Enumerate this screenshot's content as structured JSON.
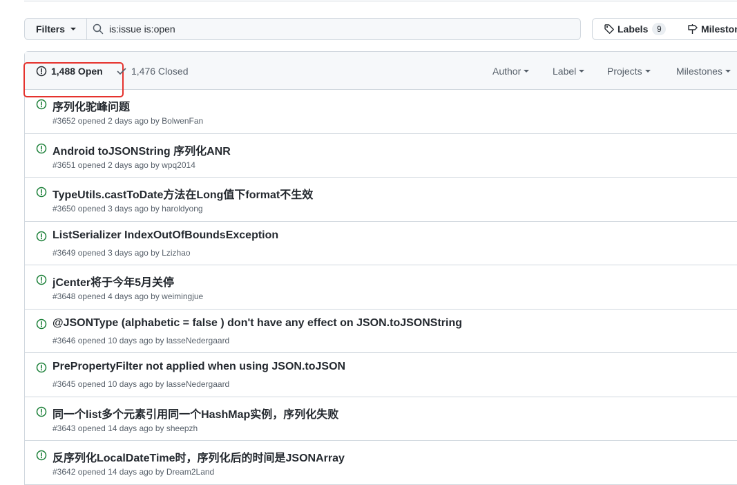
{
  "toolbar": {
    "filters_label": "Filters",
    "search_value": "is:issue is:open",
    "labels_label": "Labels",
    "labels_count": "9",
    "milestones_label": "Milestones"
  },
  "header": {
    "open_label": "1,488 Open",
    "closed_label": "1,476 Closed",
    "menus": [
      "Author",
      "Label",
      "Projects",
      "Milestones"
    ]
  },
  "colors": {
    "open_green": "#1a7f37",
    "highlight_red": "#e5322d"
  },
  "issues": [
    {
      "title": "序列化驼峰问题",
      "number": "#3652",
      "opened": "opened 2 days ago by",
      "author": "BolwenFan"
    },
    {
      "title": "Android toJSONString 序列化ANR",
      "number": "#3651",
      "opened": "opened 2 days ago by",
      "author": "wpq2014"
    },
    {
      "title": "TypeUtils.castToDate方法在Long值下format不生效",
      "number": "#3650",
      "opened": "opened 3 days ago by",
      "author": "haroldyong"
    },
    {
      "title": "ListSerializer IndexOutOfBoundsException",
      "number": "#3649",
      "opened": "opened 3 days ago by",
      "author": "Lzizhao"
    },
    {
      "title": "jCenter将于今年5月关停",
      "number": "#3648",
      "opened": "opened 4 days ago by",
      "author": "weimingjue"
    },
    {
      "title": "@JSONType (alphabetic = false ) don't have any effect on JSON.toJSONString",
      "number": "#3646",
      "opened": "opened 10 days ago by",
      "author": "lasseNedergaard"
    },
    {
      "title": "PrePropertyFilter not applied when using JSON.toJSON",
      "number": "#3645",
      "opened": "opened 10 days ago by",
      "author": "lasseNedergaard"
    },
    {
      "title": "同一个list多个元素引用同一个HashMap实例，序列化失败",
      "number": "#3643",
      "opened": "opened 14 days ago by",
      "author": "sheepzh"
    },
    {
      "title": "反序列化LocalDateTime时，序列化后的时间是JSONArray",
      "number": "#3642",
      "opened": "opened 14 days ago by",
      "author": "Dream2Land"
    }
  ]
}
